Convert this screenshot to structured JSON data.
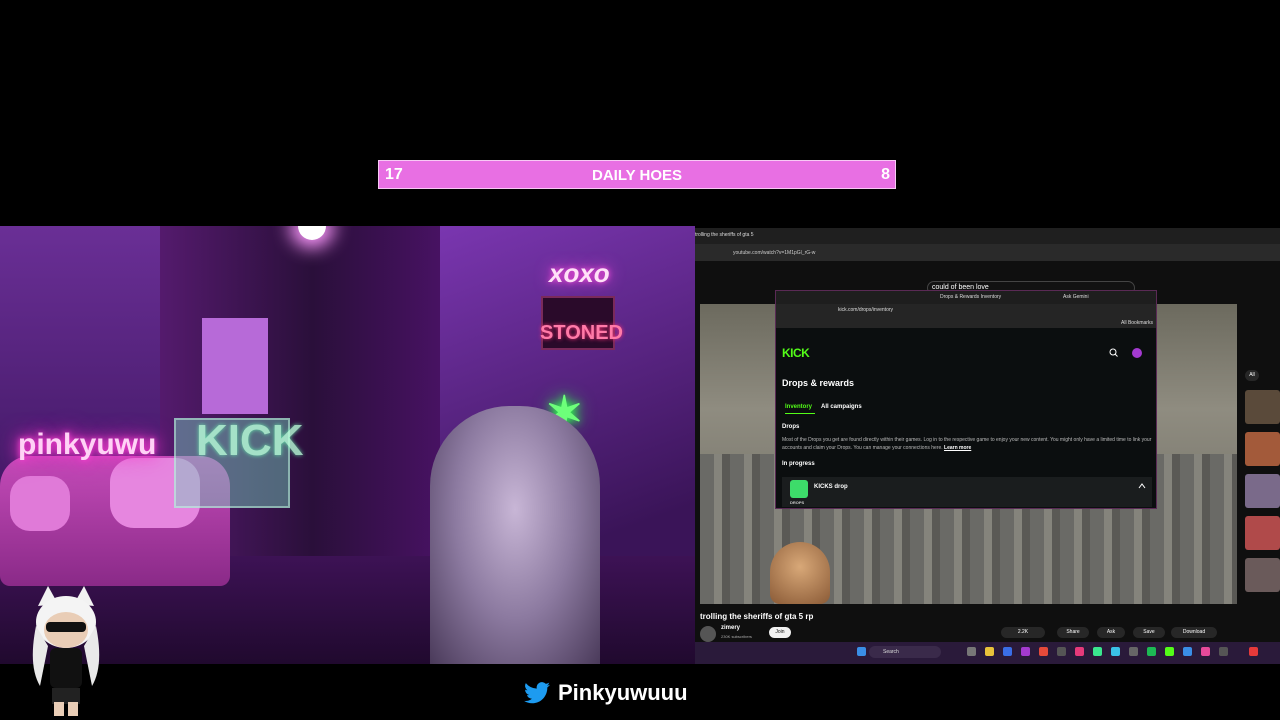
{
  "counter": {
    "left": "17",
    "title": "DAILY HOES",
    "right": "8",
    "color": "#e86fe3"
  },
  "webcam": {
    "neon_signs": {
      "name": "pinkyuwu",
      "brand": "KICK",
      "xoxo": "xoxo",
      "stoned": "STONED"
    }
  },
  "screen": {
    "browser_tab": "trolling the sheriffs of gta 5",
    "browser_url": "youtube.com/watch?v=1M1pGl_rG-w",
    "yt_search": "could of been love",
    "video": {
      "title": "trolling the sheriffs of gta 5 rp",
      "channel": "zimery",
      "subscribers": "230K subscribers",
      "join": "Join",
      "likes": "2.2K",
      "share": "Share",
      "ask": "Ask",
      "save": "Save",
      "download": "Download"
    },
    "sidebar_all": "All",
    "taskbar_search": "Search",
    "kick_window": {
      "tab_title": "Drops & Rewards Inventory",
      "ask_gemini": "Ask Gemini",
      "url": "kick.com/drops/inventory",
      "bookmarks": "All Bookmarks",
      "logo": "KICK",
      "page_title": "Drops & rewards",
      "tabs": [
        "Inventory",
        "All campaigns"
      ],
      "drops_heading": "Drops",
      "drops_description": "Most of the Drops you get are found directly within their games. Log in to the respective game to enjoy your new content. You might only have a limited time to link your accounts and claim your Drops. You can manage your connections here.",
      "learn_more": "Learn more",
      "in_progress": "In progress",
      "drop_name": "KICKS drop",
      "drop_label": "DROPS",
      "accent": "#53fc18"
    }
  },
  "twitter": {
    "handle": "Pinkyuwuuu",
    "icon": "twitter-bird-icon"
  }
}
